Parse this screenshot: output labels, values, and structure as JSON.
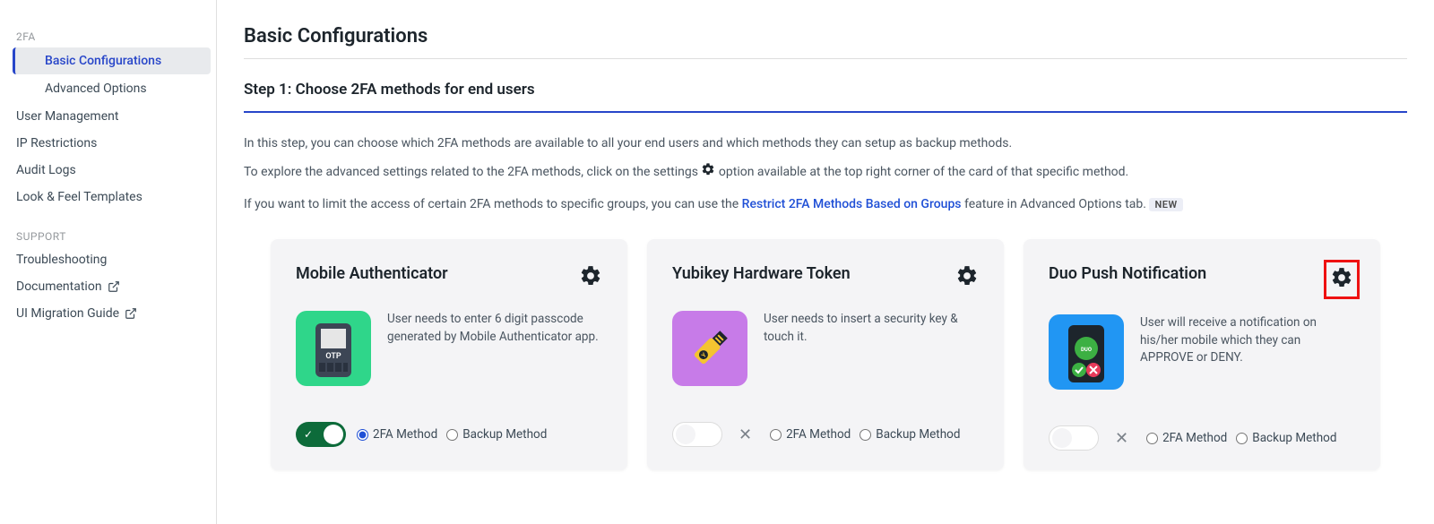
{
  "sidebar": {
    "section1": "2FA",
    "sub_basic": "Basic Configurations",
    "sub_advanced": "Advanced Options",
    "user_mgmt": "User Management",
    "ip_restrict": "IP Restrictions",
    "audit": "Audit Logs",
    "lookfeel": "Look & Feel Templates",
    "section2": "SUPPORT",
    "troubleshoot": "Troubleshooting",
    "docs": "Documentation",
    "migration": "UI Migration Guide"
  },
  "page": {
    "title": "Basic Configurations",
    "step_title": "Step 1: Choose 2FA methods for end users",
    "desc_line1": "In this step, you can choose which 2FA methods are available to all your end users and which methods they can setup as backup methods.",
    "desc_line2a": "To explore the advanced settings related to the 2FA methods, click on the settings ",
    "desc_line2b": " option available at the top right corner of the card of that specific method.",
    "desc_line3a": "If you want to limit the access of certain 2FA methods to specific groups, you can use the ",
    "desc_link": "Restrict 2FA Methods Based on Groups",
    "desc_line3b": " feature in Advanced Options tab. ",
    "new_badge": "NEW"
  },
  "radio_labels": {
    "method": "2FA Method",
    "backup": "Backup Method"
  },
  "cards": [
    {
      "title": "Mobile Authenticator",
      "desc": "User needs to enter 6 digit passcode generated by Mobile Authenticator app.",
      "enabled": true,
      "selected": "method",
      "gear_highlight": false,
      "icon_bg": "#2fd68a"
    },
    {
      "title": "Yubikey Hardware Token",
      "desc": "User needs to insert a security key & touch it.",
      "enabled": false,
      "selected": null,
      "gear_highlight": false,
      "icon_bg": "#c77be8"
    },
    {
      "title": "Duo Push Notification",
      "desc": "User will receive a notification on his/her mobile which they can APPROVE or DENY.",
      "enabled": false,
      "selected": null,
      "gear_highlight": true,
      "icon_bg": "#2196f3"
    }
  ]
}
